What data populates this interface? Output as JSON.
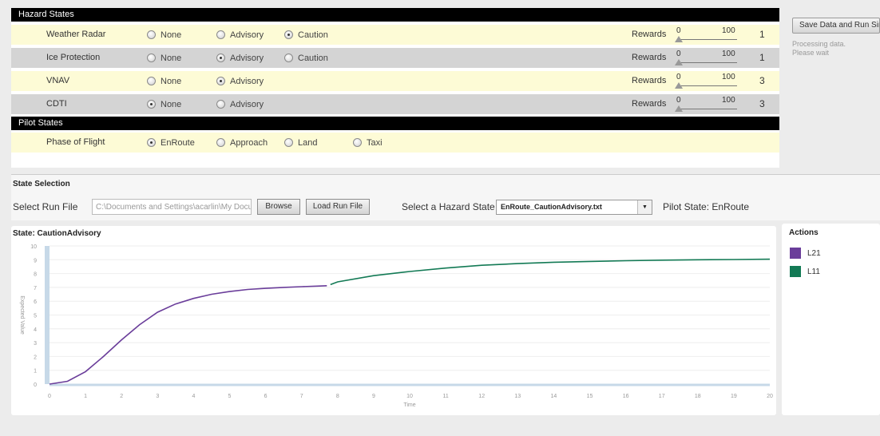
{
  "hazard": {
    "header": "Hazard States",
    "rewards_label": "Rewards",
    "slider_min": "0",
    "slider_max": "100",
    "rows": [
      {
        "label": "Weather Radar",
        "options": [
          "None",
          "Advisory",
          "Caution"
        ],
        "selected": "Caution",
        "reward": "1"
      },
      {
        "label": "Ice Protection",
        "options": [
          "None",
          "Advisory",
          "Caution"
        ],
        "selected": "Advisory",
        "reward": "1"
      },
      {
        "label": "VNAV",
        "options": [
          "None",
          "Advisory"
        ],
        "selected": "Advisory",
        "reward": "3"
      },
      {
        "label": "CDTI",
        "options": [
          "None",
          "Advisory"
        ],
        "selected": "None",
        "reward": "3"
      }
    ]
  },
  "pilot": {
    "header": "Pilot States",
    "label": "Phase of Flight",
    "options": [
      "EnRoute",
      "Approach",
      "Land",
      "Taxi"
    ],
    "selected": "EnRoute"
  },
  "side": {
    "save_button": "Save Data and Run Simulation",
    "processing_line1": "Processing data.",
    "processing_line2": "Please wait"
  },
  "state_selection": {
    "title": "State Selection",
    "select_run_file_label": "Select Run File",
    "path_value": "C:\\Documents and Settings\\acarlin\\My Documents",
    "browse_button": "Browse",
    "load_button": "Load Run File",
    "hazard_state_label": "Select a Hazard State",
    "hazard_state_value": "EnRoute_CautionAdvisory.txt",
    "pilot_state": "Pilot State: EnRoute"
  },
  "actions": {
    "title": "Actions",
    "items": [
      {
        "label": "L21",
        "color": "#6a3d9a"
      },
      {
        "label": "L11",
        "color": "#137a55"
      }
    ]
  },
  "chart_data": {
    "type": "line",
    "title": "State: CautionAdvisory",
    "xlabel": "Time",
    "ylabel": "Expected Value",
    "xlim": [
      0,
      20
    ],
    "ylim": [
      0,
      10
    ],
    "xticks": [
      0,
      1,
      2,
      3,
      4,
      5,
      6,
      7,
      8,
      9,
      10,
      11,
      12,
      13,
      14,
      15,
      16,
      17,
      18,
      19,
      20
    ],
    "yticks": [
      0,
      1,
      2,
      3,
      4,
      5,
      6,
      7,
      8,
      9,
      10
    ],
    "grid": true,
    "series": [
      {
        "name": "L21",
        "color": "#6a3d9a",
        "x": [
          0,
          0.5,
          1,
          1.5,
          2,
          2.5,
          3,
          3.5,
          4,
          4.5,
          5,
          5.5,
          6,
          6.5,
          7,
          7.5,
          7.7
        ],
        "y": [
          0,
          0.2,
          0.9,
          2.0,
          3.2,
          4.3,
          5.2,
          5.8,
          6.2,
          6.5,
          6.7,
          6.85,
          6.93,
          7.0,
          7.05,
          7.1,
          7.12
        ]
      },
      {
        "name": "L11",
        "color": "#137a55",
        "x": [
          7.8,
          8,
          9,
          10,
          11,
          12,
          13,
          14,
          15,
          16,
          17,
          18,
          19,
          20
        ],
        "y": [
          7.2,
          7.4,
          7.85,
          8.15,
          8.4,
          8.6,
          8.72,
          8.82,
          8.88,
          8.93,
          8.97,
          9.0,
          9.02,
          9.04
        ]
      }
    ]
  }
}
